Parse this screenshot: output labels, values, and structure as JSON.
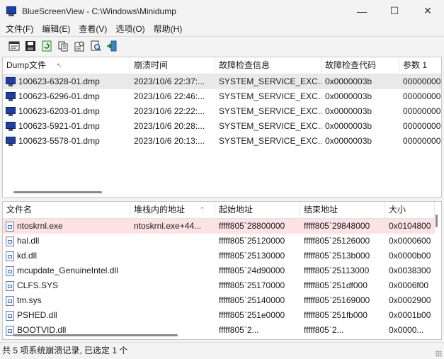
{
  "window": {
    "title": "BlueScreenView  -  C:\\Windows\\Minidump",
    "minimize": "—",
    "maximize": "☐",
    "close": "✕"
  },
  "menu": [
    "文件(F)",
    "编辑(E)",
    "查看(V)",
    "选项(O)",
    "帮助(H)"
  ],
  "toolbar": [
    {
      "icon": "html-report-icon"
    },
    {
      "icon": "save-icon"
    },
    {
      "icon": "refresh-icon"
    },
    {
      "icon": "copy-icon"
    },
    {
      "icon": "properties-icon"
    },
    {
      "icon": "find-icon"
    },
    {
      "icon": "exit-icon"
    }
  ],
  "dumps": {
    "columns": [
      "Dump文件",
      "崩溃时间",
      "故障检查信息",
      "故障检查代码",
      "参数 1"
    ],
    "sort_indicator": "↖",
    "rows": [
      [
        "100623-6328-01.dmp",
        "2023/10/6 22:37:...",
        "SYSTEM_SERVICE_EXC...",
        "0x0000003b",
        "00000000"
      ],
      [
        "100623-6296-01.dmp",
        "2023/10/6 22:46:...",
        "SYSTEM_SERVICE_EXC...",
        "0x0000003b",
        "00000000"
      ],
      [
        "100623-6203-01.dmp",
        "2023/10/6 22:22:...",
        "SYSTEM_SERVICE_EXC...",
        "0x0000003b",
        "00000000"
      ],
      [
        "100623-5921-01.dmp",
        "2023/10/6 20:28:...",
        "SYSTEM_SERVICE_EXC...",
        "0x0000003b",
        "00000000"
      ],
      [
        "100623-5578-01.dmp",
        "2023/10/6 20:13:...",
        "SYSTEM_SERVICE_EXC...",
        "0x0000003b",
        "00000000"
      ]
    ]
  },
  "modules": {
    "columns": [
      "文件名",
      "堆栈内的地址",
      "起始地址",
      "结束地址",
      "大小"
    ],
    "sort_indicator": "⌃",
    "rows": [
      [
        "ntoskrnl.exe",
        "ntoskrnl.exe+44...",
        "fffff805`28800000",
        "fffff805`29848000",
        "0x0104800"
      ],
      [
        "hal.dll",
        "",
        "fffff805`25120000",
        "fffff805`25126000",
        "0x0000600"
      ],
      [
        "kd.dll",
        "",
        "fffff805`25130000",
        "fffff805`2513b000",
        "0x0000b00"
      ],
      [
        "mcupdate_GenuineIntel.dll",
        "",
        "fffff805`24d90000",
        "fffff805`25113000",
        "0x0038300"
      ],
      [
        "CLFS.SYS",
        "",
        "fffff805`25170000",
        "fffff805`251df000",
        "0x0006f00"
      ],
      [
        "tm.sys",
        "",
        "fffff805`25140000",
        "fffff805`25169000",
        "0x0002900"
      ],
      [
        "PSHED.dll",
        "",
        "fffff805`251e0000",
        "fffff805`251fb000",
        "0x0001b00"
      ],
      [
        "BOOTVID.dll",
        "",
        "fffff805`2...",
        "fffff805`2...",
        "0x0000..."
      ]
    ]
  },
  "status": "共 5 项系统崩溃记录, 已选定 1 个"
}
